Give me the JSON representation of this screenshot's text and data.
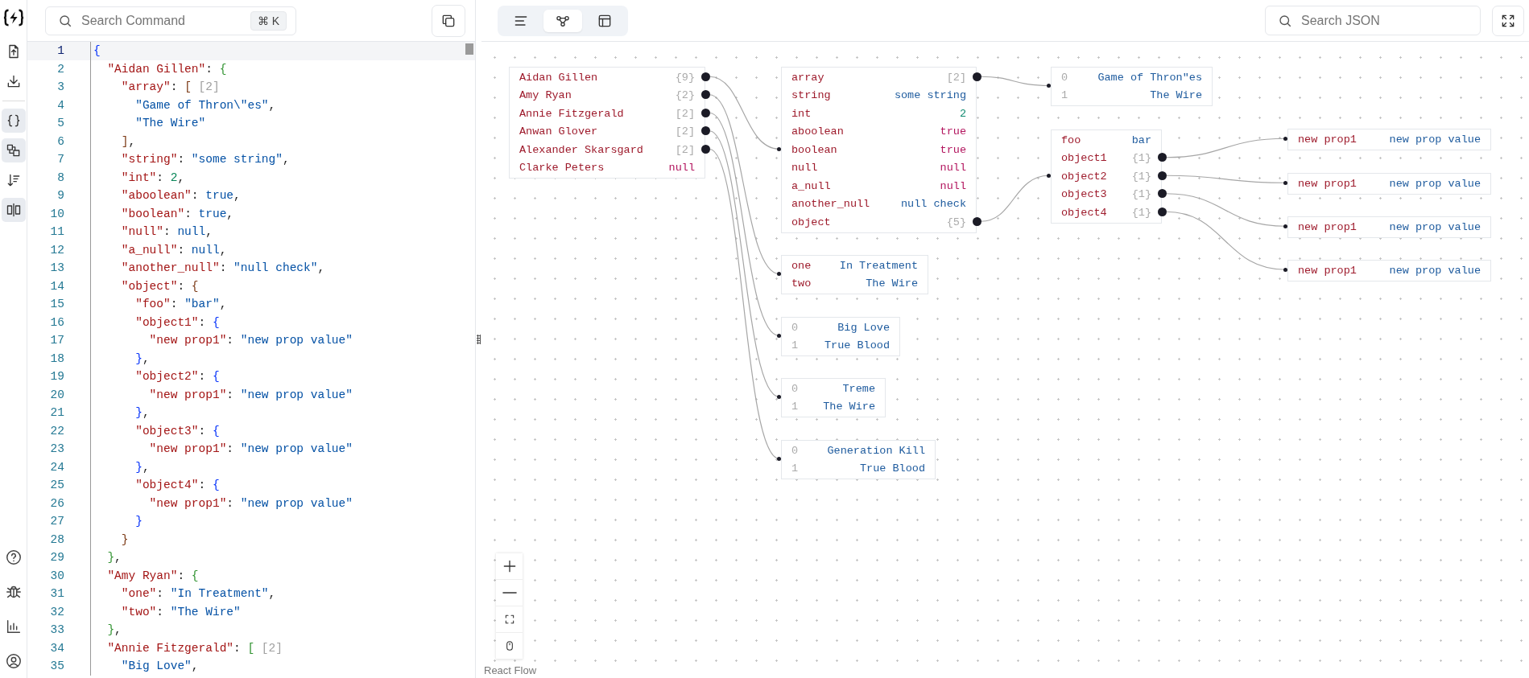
{
  "sidebar": {
    "tools": [
      {
        "selected": false
      },
      {
        "selected": false
      },
      {
        "selected": true
      },
      {
        "selected": true
      },
      {
        "selected": false
      },
      {
        "selected": true
      }
    ]
  },
  "editor": {
    "search": {
      "placeholder": "Search Command",
      "shortcut": "⌘ K"
    },
    "lines": [
      {
        "number": "1",
        "current": true,
        "tokens": [
          {
            "text": "{",
            "kind": "bracket_a"
          }
        ]
      },
      {
        "number": "2",
        "current": false,
        "tokens": [
          {
            "text": "  \"Aidan Gillen\"",
            "kind": "key"
          },
          {
            "text": ": ",
            "kind": "punct"
          },
          {
            "text": "{",
            "kind": "bracket_b"
          }
        ]
      },
      {
        "number": "3",
        "current": false,
        "tokens": [
          {
            "text": "    \"array\"",
            "kind": "key"
          },
          {
            "text": ": ",
            "kind": "punct"
          },
          {
            "text": "[",
            "kind": "bracket_c"
          },
          {
            "text": "[2]",
            "kind": "hint"
          }
        ]
      },
      {
        "number": "4",
        "current": false,
        "tokens": [
          {
            "text": "      \"Game of Thron\\\"es\"",
            "kind": "string"
          },
          {
            "text": ",",
            "kind": "punct"
          }
        ]
      },
      {
        "number": "5",
        "current": false,
        "tokens": [
          {
            "text": "      \"The Wire\"",
            "kind": "string"
          }
        ]
      },
      {
        "number": "6",
        "current": false,
        "tokens": [
          {
            "text": "    ]",
            "kind": "bracket_c"
          },
          {
            "text": ",",
            "kind": "punct"
          }
        ]
      },
      {
        "number": "7",
        "current": false,
        "tokens": [
          {
            "text": "    \"string\"",
            "kind": "key"
          },
          {
            "text": ": ",
            "kind": "punct"
          },
          {
            "text": "\"some string\"",
            "kind": "string"
          },
          {
            "text": ",",
            "kind": "punct"
          }
        ]
      },
      {
        "number": "8",
        "current": false,
        "tokens": [
          {
            "text": "    \"int\"",
            "kind": "key"
          },
          {
            "text": ": ",
            "kind": "punct"
          },
          {
            "text": "2",
            "kind": "number"
          },
          {
            "text": ",",
            "kind": "punct"
          }
        ]
      },
      {
        "number": "9",
        "current": false,
        "tokens": [
          {
            "text": "    \"aboolean\"",
            "kind": "key"
          },
          {
            "text": ": ",
            "kind": "punct"
          },
          {
            "text": "true",
            "kind": "boolean"
          },
          {
            "text": ",",
            "kind": "punct"
          }
        ]
      },
      {
        "number": "10",
        "current": false,
        "tokens": [
          {
            "text": "    \"boolean\"",
            "kind": "key"
          },
          {
            "text": ": ",
            "kind": "punct"
          },
          {
            "text": "true",
            "kind": "boolean"
          },
          {
            "text": ",",
            "kind": "punct"
          }
        ]
      },
      {
        "number": "11",
        "current": false,
        "tokens": [
          {
            "text": "    \"null\"",
            "kind": "key"
          },
          {
            "text": ": ",
            "kind": "punct"
          },
          {
            "text": "null",
            "kind": "null"
          },
          {
            "text": ",",
            "kind": "punct"
          }
        ]
      },
      {
        "number": "12",
        "current": false,
        "tokens": [
          {
            "text": "    \"a_null\"",
            "kind": "key"
          },
          {
            "text": ": ",
            "kind": "punct"
          },
          {
            "text": "null",
            "kind": "null"
          },
          {
            "text": ",",
            "kind": "punct"
          }
        ]
      },
      {
        "number": "13",
        "current": false,
        "tokens": [
          {
            "text": "    \"another_null\"",
            "kind": "key"
          },
          {
            "text": ": ",
            "kind": "punct"
          },
          {
            "text": "\"null check\"",
            "kind": "string"
          },
          {
            "text": ",",
            "kind": "punct"
          }
        ]
      },
      {
        "number": "14",
        "current": false,
        "tokens": [
          {
            "text": "    \"object\"",
            "kind": "key"
          },
          {
            "text": ": ",
            "kind": "punct"
          },
          {
            "text": "{",
            "kind": "bracket_c"
          }
        ]
      },
      {
        "number": "15",
        "current": false,
        "tokens": [
          {
            "text": "      \"foo\"",
            "kind": "key"
          },
          {
            "text": ": ",
            "kind": "punct"
          },
          {
            "text": "\"bar\"",
            "kind": "string"
          },
          {
            "text": ",",
            "kind": "punct"
          }
        ]
      },
      {
        "number": "16",
        "current": false,
        "tokens": [
          {
            "text": "      \"object1\"",
            "kind": "key"
          },
          {
            "text": ": ",
            "kind": "punct"
          },
          {
            "text": "{",
            "kind": "bracket_a"
          }
        ]
      },
      {
        "number": "17",
        "current": false,
        "tokens": [
          {
            "text": "        \"new prop1\"",
            "kind": "key"
          },
          {
            "text": ": ",
            "kind": "punct"
          },
          {
            "text": "\"new prop value\"",
            "kind": "string"
          }
        ]
      },
      {
        "number": "18",
        "current": false,
        "tokens": [
          {
            "text": "      }",
            "kind": "bracket_a"
          },
          {
            "text": ",",
            "kind": "punct"
          }
        ]
      },
      {
        "number": "19",
        "current": false,
        "tokens": [
          {
            "text": "      \"object2\"",
            "kind": "key"
          },
          {
            "text": ": ",
            "kind": "punct"
          },
          {
            "text": "{",
            "kind": "bracket_a"
          }
        ]
      },
      {
        "number": "20",
        "current": false,
        "tokens": [
          {
            "text": "        \"new prop1\"",
            "kind": "key"
          },
          {
            "text": ": ",
            "kind": "punct"
          },
          {
            "text": "\"new prop value\"",
            "kind": "string"
          }
        ]
      },
      {
        "number": "21",
        "current": false,
        "tokens": [
          {
            "text": "      }",
            "kind": "bracket_a"
          },
          {
            "text": ",",
            "kind": "punct"
          }
        ]
      },
      {
        "number": "22",
        "current": false,
        "tokens": [
          {
            "text": "      \"object3\"",
            "kind": "key"
          },
          {
            "text": ": ",
            "kind": "punct"
          },
          {
            "text": "{",
            "kind": "bracket_a"
          }
        ]
      },
      {
        "number": "23",
        "current": false,
        "tokens": [
          {
            "text": "        \"new prop1\"",
            "kind": "key"
          },
          {
            "text": ": ",
            "kind": "punct"
          },
          {
            "text": "\"new prop value\"",
            "kind": "string"
          }
        ]
      },
      {
        "number": "24",
        "current": false,
        "tokens": [
          {
            "text": "      }",
            "kind": "bracket_a"
          },
          {
            "text": ",",
            "kind": "punct"
          }
        ]
      },
      {
        "number": "25",
        "current": false,
        "tokens": [
          {
            "text": "      \"object4\"",
            "kind": "key"
          },
          {
            "text": ": ",
            "kind": "punct"
          },
          {
            "text": "{",
            "kind": "bracket_a"
          }
        ]
      },
      {
        "number": "26",
        "current": false,
        "tokens": [
          {
            "text": "        \"new prop1\"",
            "kind": "key"
          },
          {
            "text": ": ",
            "kind": "punct"
          },
          {
            "text": "\"new prop value\"",
            "kind": "string"
          }
        ]
      },
      {
        "number": "27",
        "current": false,
        "tokens": [
          {
            "text": "      }",
            "kind": "bracket_a"
          }
        ]
      },
      {
        "number": "28",
        "current": false,
        "tokens": [
          {
            "text": "    }",
            "kind": "bracket_c"
          }
        ]
      },
      {
        "number": "29",
        "current": false,
        "tokens": [
          {
            "text": "  }",
            "kind": "bracket_b"
          },
          {
            "text": ",",
            "kind": "punct"
          }
        ]
      },
      {
        "number": "30",
        "current": false,
        "tokens": [
          {
            "text": "  \"Amy Ryan\"",
            "kind": "key"
          },
          {
            "text": ": ",
            "kind": "punct"
          },
          {
            "text": "{",
            "kind": "bracket_b"
          }
        ]
      },
      {
        "number": "31",
        "current": false,
        "tokens": [
          {
            "text": "    \"one\"",
            "kind": "key"
          },
          {
            "text": ": ",
            "kind": "punct"
          },
          {
            "text": "\"In Treatment\"",
            "kind": "string"
          },
          {
            "text": ",",
            "kind": "punct"
          }
        ]
      },
      {
        "number": "32",
        "current": false,
        "tokens": [
          {
            "text": "    \"two\"",
            "kind": "key"
          },
          {
            "text": ": ",
            "kind": "punct"
          },
          {
            "text": "\"The Wire\"",
            "kind": "string"
          }
        ]
      },
      {
        "number": "33",
        "current": false,
        "tokens": [
          {
            "text": "  }",
            "kind": "bracket_b"
          },
          {
            "text": ",",
            "kind": "punct"
          }
        ]
      },
      {
        "number": "34",
        "current": false,
        "tokens": [
          {
            "text": "  \"Annie Fitzgerald\"",
            "kind": "key"
          },
          {
            "text": ": ",
            "kind": "punct"
          },
          {
            "text": "[",
            "kind": "bracket_b"
          },
          {
            "text": "[2]",
            "kind": "hint"
          }
        ]
      },
      {
        "number": "35",
        "current": false,
        "tokens": [
          {
            "text": "    \"Big Love\"",
            "kind": "string"
          },
          {
            "text": ",",
            "kind": "punct"
          }
        ]
      }
    ]
  },
  "graph": {
    "views": [
      {
        "selected": false
      },
      {
        "selected": true
      },
      {
        "selected": false
      }
    ],
    "search": {
      "placeholder": "Search JSON"
    },
    "attribution": "React Flow",
    "root": {
      "rows": [
        {
          "key": {
            "text": "Aidan Gillen",
            "kind": "key"
          },
          "value": {
            "text": "{9}",
            "kind": "count"
          },
          "child": {
            "rows": [
              {
                "key": {
                  "text": "array",
                  "kind": "key"
                },
                "value": {
                  "text": "[2]",
                  "kind": "count"
                },
                "child": {
                  "rows": [
                    {
                      "key": {
                        "text": "0",
                        "kind": "index"
                      },
                      "value": {
                        "text": "Game of Thron\"es",
                        "kind": "string"
                      }
                    },
                    {
                      "key": {
                        "text": "1",
                        "kind": "index"
                      },
                      "value": {
                        "text": "The Wire",
                        "kind": "string"
                      }
                    }
                  ]
                }
              },
              {
                "key": {
                  "text": "string",
                  "kind": "key"
                },
                "value": {
                  "text": "some string",
                  "kind": "string"
                }
              },
              {
                "key": {
                  "text": "int",
                  "kind": "key"
                },
                "value": {
                  "text": "2",
                  "kind": "number"
                }
              },
              {
                "key": {
                  "text": "aboolean",
                  "kind": "key"
                },
                "value": {
                  "text": "true",
                  "kind": "boolean"
                }
              },
              {
                "key": {
                  "text": "boolean",
                  "kind": "key"
                },
                "value": {
                  "text": "true",
                  "kind": "boolean"
                }
              },
              {
                "key": {
                  "text": "null",
                  "kind": "key"
                },
                "value": {
                  "text": "null",
                  "kind": "null"
                }
              },
              {
                "key": {
                  "text": "a_null",
                  "kind": "key"
                },
                "value": {
                  "text": "null",
                  "kind": "null"
                }
              },
              {
                "key": {
                  "text": "another_null",
                  "kind": "key"
                },
                "value": {
                  "text": "null check",
                  "kind": "string"
                }
              },
              {
                "key": {
                  "text": "object",
                  "kind": "key"
                },
                "value": {
                  "text": "{5}",
                  "kind": "count"
                },
                "child": {
                  "rows": [
                    {
                      "key": {
                        "text": "foo",
                        "kind": "key"
                      },
                      "value": {
                        "text": "bar",
                        "kind": "string"
                      }
                    },
                    {
                      "key": {
                        "text": "object1",
                        "kind": "key"
                      },
                      "value": {
                        "text": "{1}",
                        "kind": "count"
                      },
                      "child": {
                        "rows": [
                          {
                            "key": {
                              "text": "new prop1",
                              "kind": "key"
                            },
                            "value": {
                              "text": "new prop value",
                              "kind": "string"
                            }
                          }
                        ]
                      }
                    },
                    {
                      "key": {
                        "text": "object2",
                        "kind": "key"
                      },
                      "value": {
                        "text": "{1}",
                        "kind": "count"
                      },
                      "child": {
                        "rows": [
                          {
                            "key": {
                              "text": "new prop1",
                              "kind": "key"
                            },
                            "value": {
                              "text": "new prop value",
                              "kind": "string"
                            }
                          }
                        ]
                      }
                    },
                    {
                      "key": {
                        "text": "object3",
                        "kind": "key"
                      },
                      "value": {
                        "text": "{1}",
                        "kind": "count"
                      },
                      "child": {
                        "rows": [
                          {
                            "key": {
                              "text": "new prop1",
                              "kind": "key"
                            },
                            "value": {
                              "text": "new prop value",
                              "kind": "string"
                            }
                          }
                        ]
                      }
                    },
                    {
                      "key": {
                        "text": "object4",
                        "kind": "key"
                      },
                      "value": {
                        "text": "{1}",
                        "kind": "count"
                      },
                      "child": {
                        "rows": [
                          {
                            "key": {
                              "text": "new prop1",
                              "kind": "key"
                            },
                            "value": {
                              "text": "new prop value",
                              "kind": "string"
                            }
                          }
                        ]
                      }
                    }
                  ]
                }
              }
            ]
          }
        },
        {
          "key": {
            "text": "Amy Ryan",
            "kind": "key"
          },
          "value": {
            "text": "{2}",
            "kind": "count"
          },
          "child": {
            "rows": [
              {
                "key": {
                  "text": "one",
                  "kind": "key"
                },
                "value": {
                  "text": "In Treatment",
                  "kind": "string"
                }
              },
              {
                "key": {
                  "text": "two",
                  "kind": "key"
                },
                "value": {
                  "text": "The Wire",
                  "kind": "string"
                }
              }
            ]
          }
        },
        {
          "key": {
            "text": "Annie Fitzgerald",
            "kind": "key"
          },
          "value": {
            "text": "[2]",
            "kind": "count"
          },
          "child": {
            "rows": [
              {
                "key": {
                  "text": "0",
                  "kind": "index"
                },
                "value": {
                  "text": "Big Love",
                  "kind": "string"
                }
              },
              {
                "key": {
                  "text": "1",
                  "kind": "index"
                },
                "value": {
                  "text": "True Blood",
                  "kind": "string"
                }
              }
            ]
          }
        },
        {
          "key": {
            "text": "Anwan Glover",
            "kind": "key"
          },
          "value": {
            "text": "[2]",
            "kind": "count"
          },
          "child": {
            "rows": [
              {
                "key": {
                  "text": "0",
                  "kind": "index"
                },
                "value": {
                  "text": "Treme",
                  "kind": "string"
                }
              },
              {
                "key": {
                  "text": "1",
                  "kind": "index"
                },
                "value": {
                  "text": "The Wire",
                  "kind": "string"
                }
              }
            ]
          }
        },
        {
          "key": {
            "text": "Alexander Skarsgard",
            "kind": "key"
          },
          "value": {
            "text": "[2]",
            "kind": "count"
          },
          "child": {
            "rows": [
              {
                "key": {
                  "text": "0",
                  "kind": "index"
                },
                "value": {
                  "text": "Generation Kill",
                  "kind": "string"
                }
              },
              {
                "key": {
                  "text": "1",
                  "kind": "index"
                },
                "value": {
                  "text": "True Blood",
                  "kind": "string"
                }
              }
            ]
          }
        },
        {
          "key": {
            "text": "Clarke Peters",
            "kind": "key"
          },
          "value": {
            "text": "null",
            "kind": "null"
          }
        }
      ]
    }
  }
}
